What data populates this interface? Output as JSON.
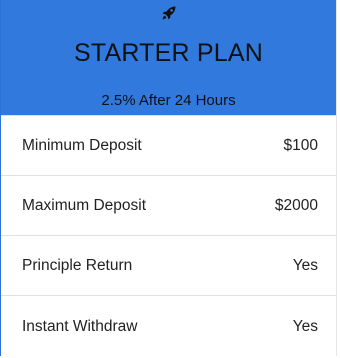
{
  "plan": {
    "icon": "rocket-icon",
    "title": "STARTER PLAN",
    "subtitle": "2.5% After 24 Hours",
    "header_color": "#3179dd"
  },
  "rows": [
    {
      "label": "Minimum Deposit",
      "value": "$100"
    },
    {
      "label": "Maximum Deposit",
      "value": "$2000"
    },
    {
      "label": "Principle Return",
      "value": "Yes"
    },
    {
      "label": "Instant Withdraw",
      "value": "Yes"
    }
  ]
}
